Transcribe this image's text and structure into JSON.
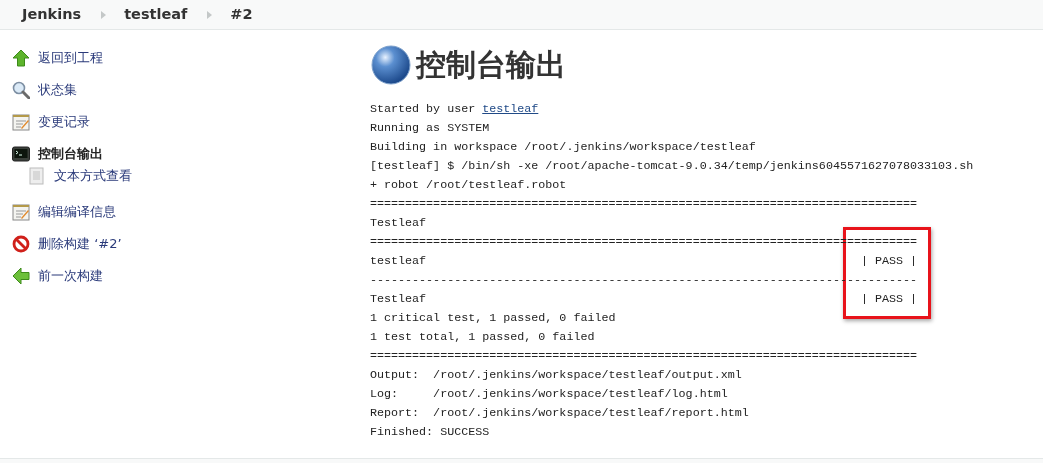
{
  "breadcrumbs": [
    {
      "label": "Jenkins"
    },
    {
      "label": "testleaf"
    },
    {
      "label": "#2"
    }
  ],
  "sidebar": {
    "items": [
      {
        "label": "返回到工程",
        "kind": "up",
        "selected": false
      },
      {
        "label": "状态集",
        "kind": "status",
        "selected": false
      },
      {
        "label": "变更记录",
        "kind": "notes",
        "selected": false
      },
      {
        "label": "控制台输出",
        "kind": "console",
        "selected": true,
        "children": [
          {
            "label": "文本方式查看",
            "kind": "page",
            "selected": false
          }
        ]
      },
      {
        "label": "编辑编译信息",
        "kind": "notes",
        "selected": false
      },
      {
        "label": "删除构建 ‘#2’",
        "kind": "delete",
        "selected": false
      },
      {
        "label": "前一次构建",
        "kind": "previous",
        "selected": false
      }
    ]
  },
  "page_title": "控制台输出",
  "console": {
    "lines": [
      {
        "kind": "link",
        "text": "Started by user ",
        "link": "testleaf"
      },
      {
        "kind": "text",
        "text": "Running as SYSTEM"
      },
      {
        "kind": "text",
        "text": "Building in workspace /root/.jenkins/workspace/testleaf"
      },
      {
        "kind": "text",
        "text": "[testleaf] $ /bin/sh -xe /root/apache-tomcat-9.0.34/temp/jenkins6045571627078033103.sh"
      },
      {
        "kind": "text",
        "text": "+ robot /root/testleaf.robot"
      },
      {
        "kind": "text",
        "text": "=============================================================================="
      },
      {
        "kind": "text",
        "text": "Testleaf"
      },
      {
        "kind": "text",
        "text": "=============================================================================="
      },
      {
        "kind": "text",
        "text": "testleaf                                                              | PASS |"
      },
      {
        "kind": "text",
        "text": "------------------------------------------------------------------------------"
      },
      {
        "kind": "text",
        "text": "Testleaf                                                              | PASS |"
      },
      {
        "kind": "text",
        "text": "1 critical test, 1 passed, 0 failed"
      },
      {
        "kind": "text",
        "text": "1 test total, 1 passed, 0 failed"
      },
      {
        "kind": "text",
        "text": "=============================================================================="
      },
      {
        "kind": "text",
        "text": "Output:  /root/.jenkins/workspace/testleaf/output.xml"
      },
      {
        "kind": "text",
        "text": "Log:     /root/.jenkins/workspace/testleaf/log.html"
      },
      {
        "kind": "text",
        "text": "Report:  /root/.jenkins/workspace/testleaf/report.html"
      },
      {
        "kind": "text",
        "text": "Finished: SUCCESS"
      }
    ]
  }
}
